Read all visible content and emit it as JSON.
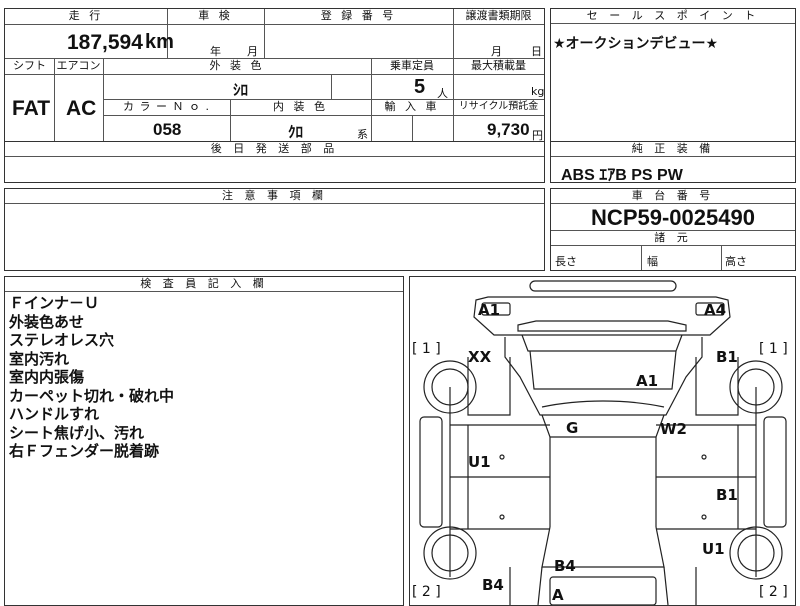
{
  "header": {
    "mileage_label": "走 行",
    "mileage_value": "187,594",
    "mileage_unit": "km",
    "inspection_label": "車 検",
    "inspection_year_unit": "年",
    "inspection_month_unit": "月",
    "registration_label": "登 録 番 号",
    "transfer_label": "譲渡書類期限",
    "transfer_month_unit": "月",
    "transfer_day_unit": "日",
    "sales_point_label": "セ ー ル ス ポ イ ン ト",
    "sales_point_text": "★オークションデビュー★"
  },
  "specs": {
    "shift_label": "シフト",
    "shift_value": "FAT",
    "aircon_label": "エアコン",
    "aircon_value": "AC",
    "exterior_color_label": "外 装 色",
    "exterior_color_value": "ｼﾛ",
    "capacity_label": "乗車定員",
    "capacity_value": "5",
    "capacity_unit": "人",
    "max_load_label": "最大積載量",
    "max_load_unit": "kg",
    "color_no_label": "カ ラ ー Ｎ ｏ .",
    "color_no_value": "058",
    "interior_color_label": "内 装 色",
    "interior_color_value": "ｸﾛ",
    "interior_color_suffix": "系",
    "import_label": "輸 入 車",
    "recycle_label": "リサイクル預託金",
    "recycle_value": "9,730",
    "recycle_unit": "円",
    "later_parts_label": "後 日 発 送 部 品"
  },
  "genuine_equipment": {
    "label": "純 正 装 備",
    "value": "ABS ｴｱB PS PW"
  },
  "notes": {
    "label": "注 意 事 項 欄"
  },
  "chassis": {
    "label": "車 台 番 号",
    "value": "NCP59-0025490",
    "dimensions_label": "諸 元",
    "length_label": "長さ",
    "width_label": "幅",
    "height_label": "高さ"
  },
  "inspector": {
    "label": "検 査 員 記 入 欄",
    "lines": [
      "Ｆインナ－Ｕ",
      "外装色あせ",
      "ステレオレス穴",
      "室内汚れ",
      "室内内張傷",
      "カーペット切れ・破れ中",
      "ハンドルすれ",
      "シート焦げ小、汚れ",
      "右Ｆフェンダー脱着跡"
    ]
  },
  "diagram": {
    "bracket_left_top": "[ 1 ]",
    "bracket_right_top": "[ 1 ]",
    "bracket_left_bottom": "[ 2 ]",
    "bracket_right_bottom": "[ 2 ]",
    "marks": {
      "a1_top": "A1",
      "a4_top": "A4",
      "xx": "XX",
      "b1_right_front": "B1",
      "a1_hood": "A1",
      "g_windshield": "G",
      "w2_windshield": "W2",
      "u1_left_door": "U1",
      "b1_right_door": "B1",
      "u1_right_rear": "U1",
      "b4_rear": "B4",
      "b4_left_rear": "B4",
      "a_bottom": "A"
    }
  }
}
